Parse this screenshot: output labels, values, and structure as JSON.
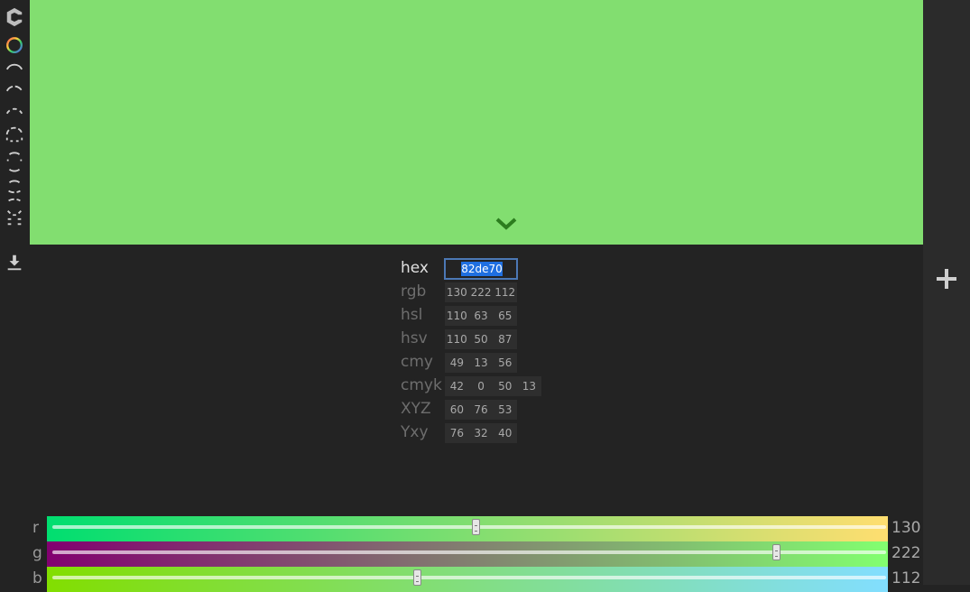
{
  "color": {
    "hex": "82de70",
    "swatch": "#82de70"
  },
  "toolbar": {
    "icons": [
      "app-logo-icon",
      "color-wheel-icon",
      "arc-solid-icon",
      "arc-dashed-icon",
      "arc-dotted-icon",
      "circle-dashed-icon",
      "arc-thin-icon",
      "arcs-mirrored-icon",
      "arcs-wide-icon",
      "arcs-broken-icon",
      "download-icon"
    ]
  },
  "values": {
    "hex": {
      "label": "hex",
      "value": "82de70"
    },
    "rgb": {
      "label": "rgb",
      "v": [
        "130",
        "222",
        "112"
      ]
    },
    "hsl": {
      "label": "hsl",
      "v": [
        "110",
        "63",
        "65"
      ]
    },
    "hsv": {
      "label": "hsv",
      "v": [
        "110",
        "50",
        "87"
      ]
    },
    "cmy": {
      "label": "cmy",
      "v": [
        "49",
        "13",
        "56"
      ]
    },
    "cmyk": {
      "label": "cmyk",
      "v": [
        "42",
        "0",
        "50",
        "13"
      ]
    },
    "xyz": {
      "label": "XYZ",
      "v": [
        "60",
        "76",
        "53"
      ]
    },
    "yxy": {
      "label": "Yxy",
      "v": [
        "76",
        "32",
        "40"
      ]
    }
  },
  "sliders": {
    "r": {
      "label": "r",
      "value": "130",
      "fraction": 0.5098
    },
    "g": {
      "label": "g",
      "value": "222",
      "fraction": 0.8706
    },
    "b": {
      "label": "b",
      "value": "112",
      "fraction": 0.4392
    }
  },
  "actions": {
    "add_icon": "plus-icon",
    "expand_icon": "chevron-down-icon"
  }
}
